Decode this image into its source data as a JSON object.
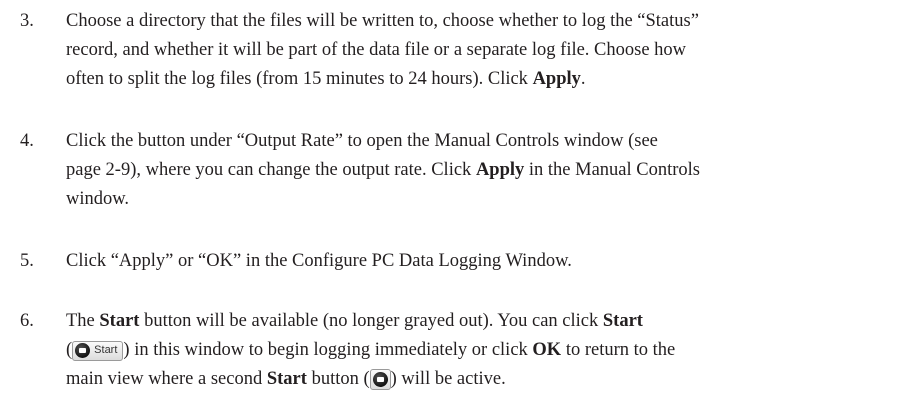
{
  "steps": [
    {
      "number": "3.",
      "lines": [
        "Choose a directory that the files will be written to, choose whether to log the “Status”",
        "record, and whether it will be part of the data file or a separate log file. Choose how",
        "often to split the log files (from 15 minutes to 24 hours). Click "
      ],
      "bold_apply": "Apply",
      "end": "."
    },
    {
      "number": "4.",
      "line1": "Click the button under “Output Rate” to open the Manual Controls window (see",
      "line2_pre": "page 2-9), where you can change the output rate. Click ",
      "line2_bold": "Apply",
      "line2_post": " in the Manual Controls",
      "line3": "window."
    },
    {
      "number": "5.",
      "line1": "Click “Apply” or “OK” in the Configure PC Data Logging Window."
    },
    {
      "number": "6.",
      "line1_pre": "The ",
      "line1_bold": "Start",
      "line1_post": " button will be available (no longer grayed out). You can click ",
      "line1_bold2": "Start",
      "line2_pre": "(",
      "button_label": "Start",
      "line2_post": ") in this window to begin logging immediately or click ",
      "line2_bold": "OK",
      "line2_tail": " to return to the",
      "line3_pre": "main view where a second ",
      "line3_bold": "Start",
      "line3_mid": " button (",
      "line3_post": ") will be active."
    }
  ],
  "icons": {
    "start_button_icon": "start-record-icon"
  }
}
